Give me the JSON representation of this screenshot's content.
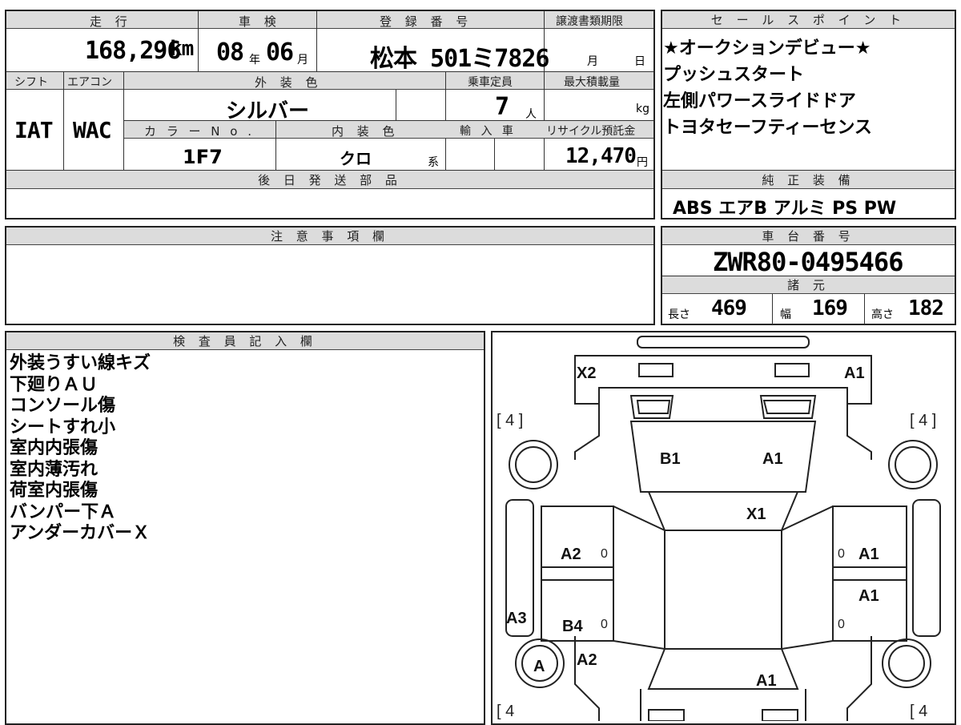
{
  "top_form": {
    "headers": {
      "mileage": "走 行",
      "shaken": "車 検",
      "registration": "登 録 番 号",
      "transfer_deadline": "譲渡書類期限",
      "shift": "シフト",
      "aircon": "エアコン",
      "exterior_color": "外 装 色",
      "capacity": "乗車定員",
      "max_load": "最大積載量",
      "color_no": "カ ラ ー N o .",
      "interior_color": "内 装 色",
      "import": "輸 入 車",
      "recycle": "リサイクル預託金",
      "later_parts": "後 日 発 送 部 品"
    },
    "mileage_value": "168,296",
    "mileage_unit": "km",
    "shaken_year": "08",
    "shaken_year_unit": "年",
    "shaken_month": "06",
    "shaken_month_unit": "月",
    "registration_number": "松本 501ミ7826",
    "transfer_month_unit": "月",
    "transfer_day_unit": "日",
    "shift_value": "IAT",
    "aircon_value": "WAC",
    "exterior_color_value": "シルバー",
    "capacity_value": "7",
    "capacity_unit": "人",
    "max_load_unit": "kg",
    "color_no_value": "1F7",
    "interior_color_value": "クロ",
    "interior_color_suffix": "系",
    "recycle_value": "12,470",
    "recycle_unit": "円"
  },
  "sales_points": {
    "header": "セ ー ル ス ポ イ ン ト",
    "items": [
      "★オークションデビュー★",
      "プッシュスタート",
      "左側パワースライドドア",
      "トヨタセーフティーセンス"
    ]
  },
  "genuine_equipment": {
    "header": "純 正 装 備",
    "value": "ABS エアB アルミ PS PW"
  },
  "caution": {
    "header": "注 意 事 項 欄"
  },
  "chassis": {
    "header": "車 台 番 号",
    "value": "ZWR80-0495466"
  },
  "specs": {
    "header": "諸 元",
    "length_label": "長さ",
    "length_value": "469",
    "width_label": "幅",
    "width_value": "169",
    "height_label": "高さ",
    "height_value": "182"
  },
  "inspector": {
    "header": "検 査 員 記 入 欄",
    "notes": [
      "外装うすい線キズ",
      "下廻りＡＵ",
      "コンソール傷",
      "シートすれ小",
      "室内内張傷",
      "室内薄汚れ",
      "荷室内張傷",
      "バンパー下Ａ",
      "アンダーカバーＸ"
    ]
  },
  "car_diagram": {
    "tire_front_left": "[ 4 ]",
    "tire_front_right": "[ 4 ]",
    "tire_rear_left": "[ 4",
    "tire_rear_right": "[ 4",
    "codes": {
      "front_left": "X2",
      "front_right": "A1",
      "hood_left": "B1",
      "hood_right": "A1",
      "windshield": "X1",
      "front_door_left": "A2",
      "front_door_right": "A1",
      "rear_door_right": "A1",
      "rear_door_left": "B4",
      "rear_fender_left": "A3",
      "rear_quarter_left": "A2",
      "rear_wheel_left": "A",
      "rear_center": "A1"
    },
    "zero_marks": [
      "0",
      "0",
      "0",
      "0"
    ]
  }
}
